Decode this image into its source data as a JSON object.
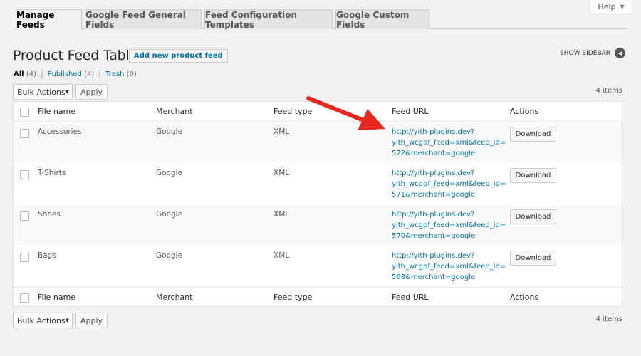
{
  "help": {
    "label": "Help"
  },
  "tabs": [
    {
      "label": "Manage Feeds",
      "active": true
    },
    {
      "label": "Google Feed General Fields"
    },
    {
      "label": "Feed Configuration Templates"
    },
    {
      "label": "Google Custom Fields"
    }
  ],
  "page": {
    "title": "Product Feed Table",
    "add_new": "Add new product feed",
    "show_sidebar": "SHOW SIDEBAR"
  },
  "views": {
    "all": "All",
    "all_count": "(4)",
    "sep1": "|",
    "published": "Published",
    "published_count": "(4)",
    "sep2": "|",
    "trash": "Trash",
    "trash_count": "(0)"
  },
  "tablenav": {
    "bulk_actions": "Bulk Actions",
    "apply": "Apply",
    "items": "4 items"
  },
  "table": {
    "columns": [
      "File name",
      "Merchant",
      "Feed type",
      "Feed URL",
      "Actions"
    ],
    "rows": [
      {
        "file": "Accessories",
        "merchant": "Google",
        "type": "XML",
        "url1": "http://yith-plugins.dev?",
        "url2": "yith_wcgpf_feed=xml&feed_id=",
        "url3": "572&merchant=google",
        "action": "Download"
      },
      {
        "file": "T-Shirts",
        "merchant": "Google",
        "type": "XML",
        "url1": "http://yith-plugins.dev?",
        "url2": "yith_wcgpf_feed=xml&feed_id=",
        "url3": "571&merchant=google",
        "action": "Download"
      },
      {
        "file": "Shoes",
        "merchant": "Google",
        "type": "XML",
        "url1": "http://yith-plugins.dev?",
        "url2": "yith_wcgpf_feed=xml&feed_id=",
        "url3": "570&merchant=google",
        "action": "Download"
      },
      {
        "file": "Bags",
        "merchant": "Google",
        "type": "XML",
        "url1": "http://yith-plugins.dev?",
        "url2": "yith_wcgpf_feed=xml&feed_id=",
        "url3": "568&merchant=google",
        "action": "Download"
      }
    ]
  },
  "colors": {
    "link": "#0073aa",
    "arrow": "#e8281f",
    "background": "#f1f1f1"
  },
  "icons": {
    "help_caret": "caret-down-icon",
    "sidebar": "arrow-left-circle-icon",
    "select_caret": "caret-down-icon"
  }
}
